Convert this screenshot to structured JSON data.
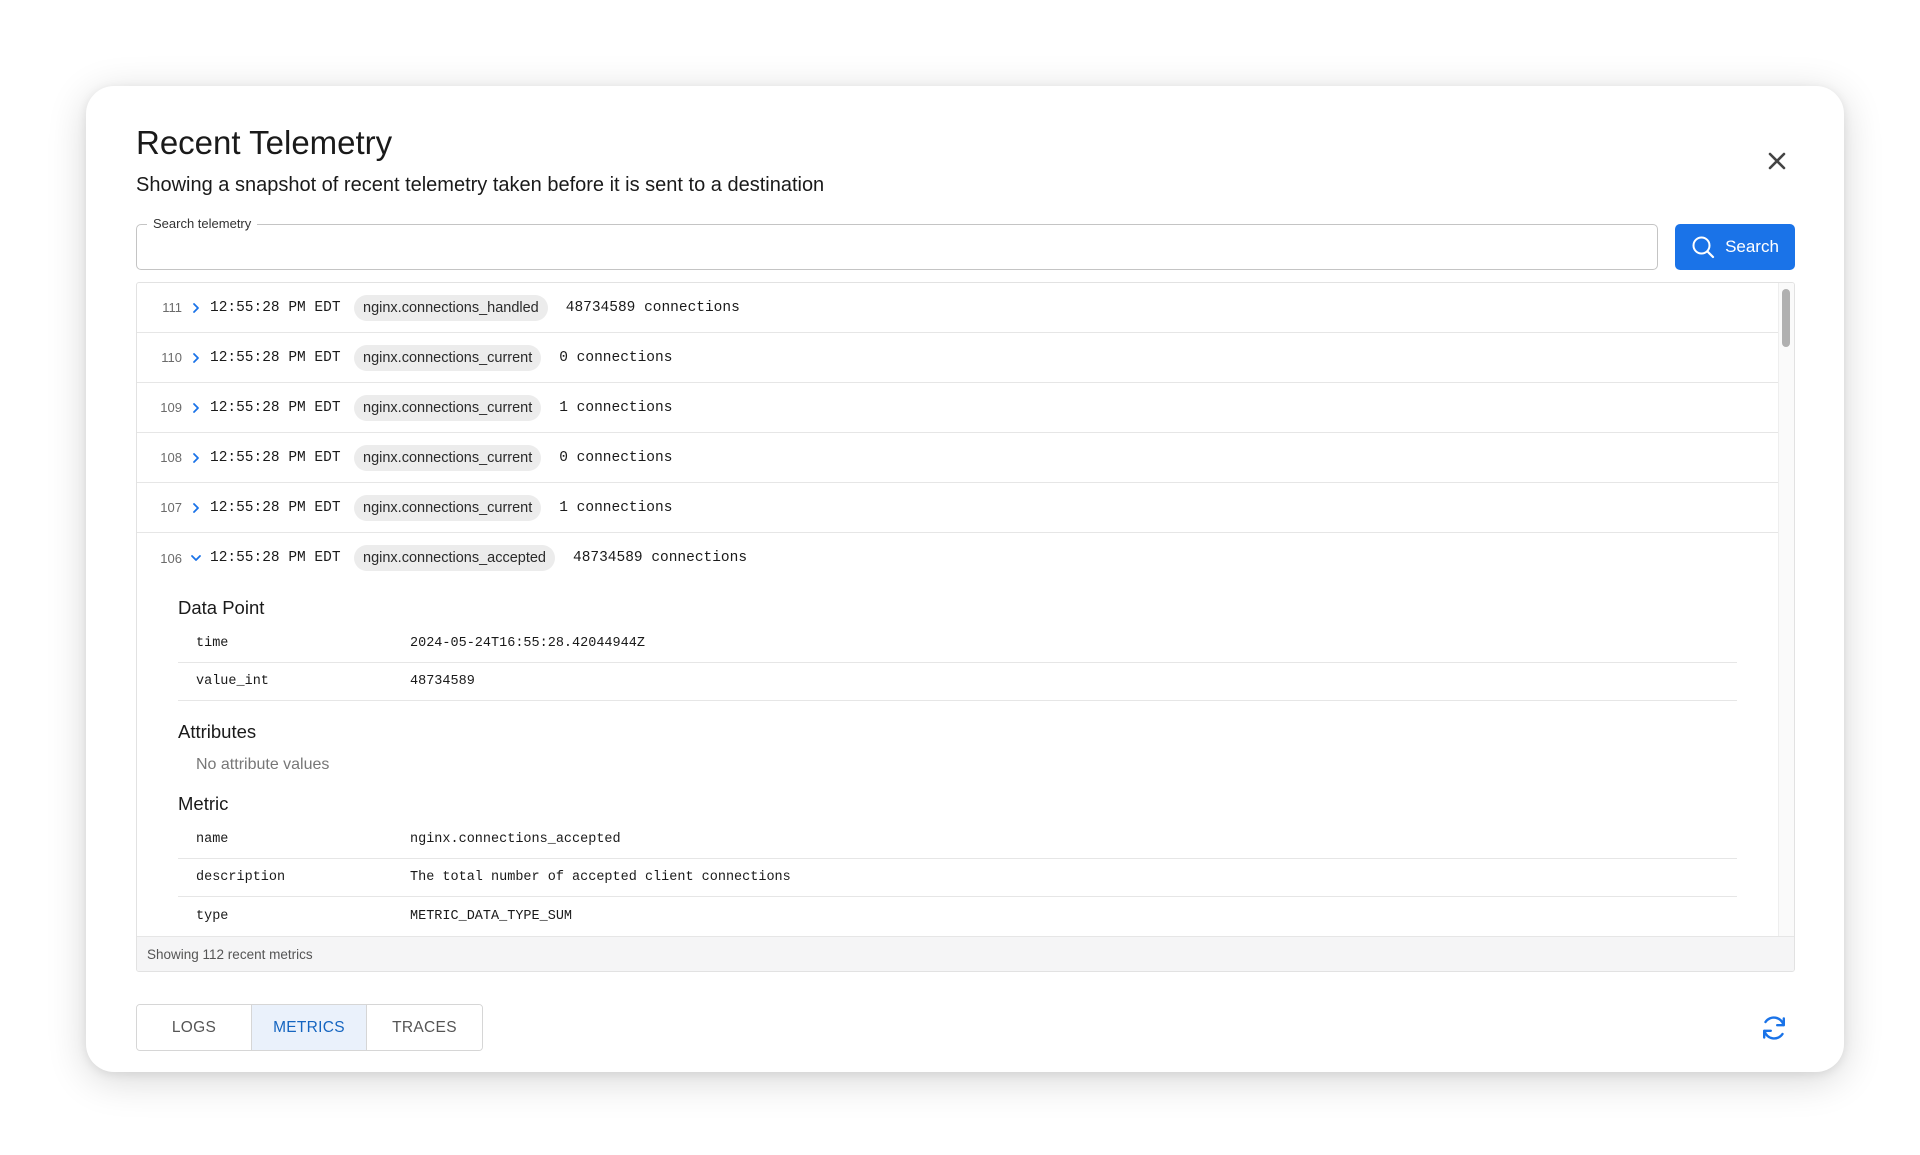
{
  "modal": {
    "title": "Recent Telemetry",
    "subtitle": "Showing a snapshot of recent telemetry taken before it is sent to a destination"
  },
  "search": {
    "label": "Search telemetry",
    "value": "",
    "button_label": "Search"
  },
  "rows": [
    {
      "index": "111",
      "time": "12:55:28 PM EDT",
      "metric": "nginx.connections_handled",
      "value": "48734589 connections",
      "expanded": false
    },
    {
      "index": "110",
      "time": "12:55:28 PM EDT",
      "metric": "nginx.connections_current",
      "value": "0 connections",
      "expanded": false
    },
    {
      "index": "109",
      "time": "12:55:28 PM EDT",
      "metric": "nginx.connections_current",
      "value": "1 connections",
      "expanded": false
    },
    {
      "index": "108",
      "time": "12:55:28 PM EDT",
      "metric": "nginx.connections_current",
      "value": "0 connections",
      "expanded": false
    },
    {
      "index": "107",
      "time": "12:55:28 PM EDT",
      "metric": "nginx.connections_current",
      "value": "1 connections",
      "expanded": false
    },
    {
      "index": "106",
      "time": "12:55:28 PM EDT",
      "metric": "nginx.connections_accepted",
      "value": "48734589 connections",
      "expanded": true
    }
  ],
  "details": {
    "data_point": {
      "title": "Data Point",
      "fields": [
        {
          "key": "time",
          "value": "2024-05-24T16:55:28.42044944Z"
        },
        {
          "key": "value_int",
          "value": "48734589"
        }
      ]
    },
    "attributes": {
      "title": "Attributes",
      "empty_text": "No attribute values"
    },
    "metric": {
      "title": "Metric",
      "fields": [
        {
          "key": "name",
          "value": "nginx.connections_accepted"
        },
        {
          "key": "description",
          "value": "The total number of accepted client connections"
        },
        {
          "key": "type",
          "value": "METRIC_DATA_TYPE_SUM"
        }
      ]
    }
  },
  "footer": {
    "status": "Showing 112 recent metrics"
  },
  "tabs": [
    {
      "label": "LOGS",
      "active": false
    },
    {
      "label": "METRICS",
      "active": true
    },
    {
      "label": "TRACES",
      "active": false
    }
  ],
  "colors": {
    "accent": "#1a73e8",
    "active_tab_bg": "#eaf1fb",
    "active_tab_text": "#1565c0"
  },
  "icons": {
    "close": "close-icon",
    "search": "search-icon",
    "expand": "chevron-right-icon",
    "collapse": "chevron-down-icon",
    "refresh": "refresh-icon"
  }
}
